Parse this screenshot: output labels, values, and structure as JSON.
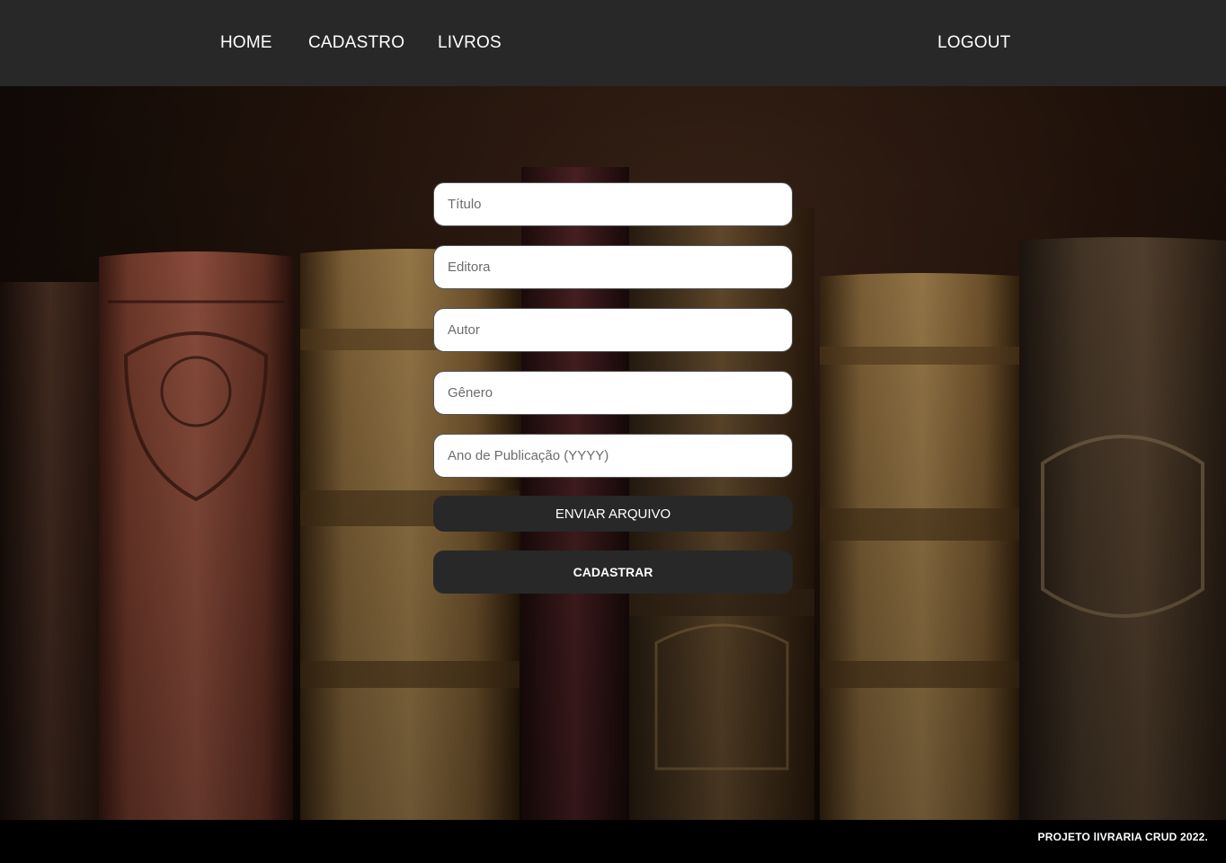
{
  "nav": {
    "home": "HOME",
    "cadastro": "CADASTRO",
    "livros": "LIVROS",
    "logout": "LOGOUT"
  },
  "hero": {
    "background_image": "bookshelf-books-photo"
  },
  "form": {
    "titulo_placeholder": "Título",
    "editora_placeholder": "Editora",
    "autor_placeholder": "Autor",
    "genero_placeholder": "Gênero",
    "ano_placeholder": "Ano de Publicação (YYYY)",
    "titulo_value": "",
    "editora_value": "",
    "autor_value": "",
    "genero_value": "",
    "ano_value": "",
    "upload_label": "ENVIAR ARQUIVO",
    "submit_label": "CADASTRAR"
  },
  "footer": {
    "text": "PROJETO lIVRARIA CRUD 2022."
  },
  "colors": {
    "nav_bg": "#282828",
    "button_bg": "#282828",
    "footer_bg": "#000000",
    "text_light": "#ffffff"
  }
}
